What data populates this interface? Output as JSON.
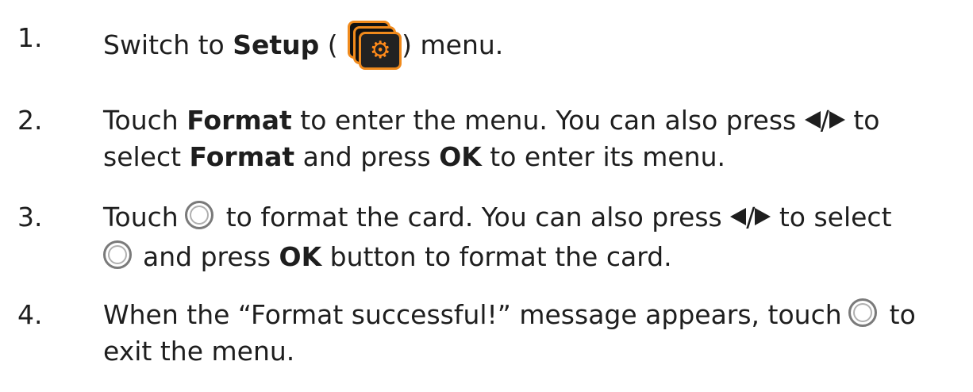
{
  "steps": [
    {
      "num": "1.",
      "lines": [
        {
          "a": "Switch to ",
          "b1": "Setup",
          "c": " (",
          "d": ") menu."
        }
      ]
    },
    {
      "num": "2.",
      "line1": {
        "a": "Touch ",
        "b": "Format",
        "c": " to enter the menu. You can also press ",
        "sep": "/",
        "d": " to"
      },
      "line2": {
        "a": "select ",
        "b": "Format",
        "c": " and press ",
        "ok": "OK",
        "d": " to enter its menu."
      }
    },
    {
      "num": "3.",
      "line1": {
        "a": "Touch",
        "b": "to format the card. You can also press ",
        "sep": "/",
        "c": " to select"
      },
      "line2": {
        "a": "and press ",
        "ok": "OK",
        "b": " button to format the card."
      }
    },
    {
      "num": "4.",
      "line1": {
        "a": "When the “Format successful!” message appears, touch",
        "b": "to"
      },
      "line2": {
        "a": "exit the menu."
      }
    }
  ],
  "icons": {
    "setup": "setup-gear-icon",
    "confirm": "confirm-circle-icon",
    "left": "left-arrow-icon",
    "right": "right-arrow-icon"
  },
  "colors": {
    "text": "#1e1e1e",
    "setup_accent": "#f08a1c"
  }
}
